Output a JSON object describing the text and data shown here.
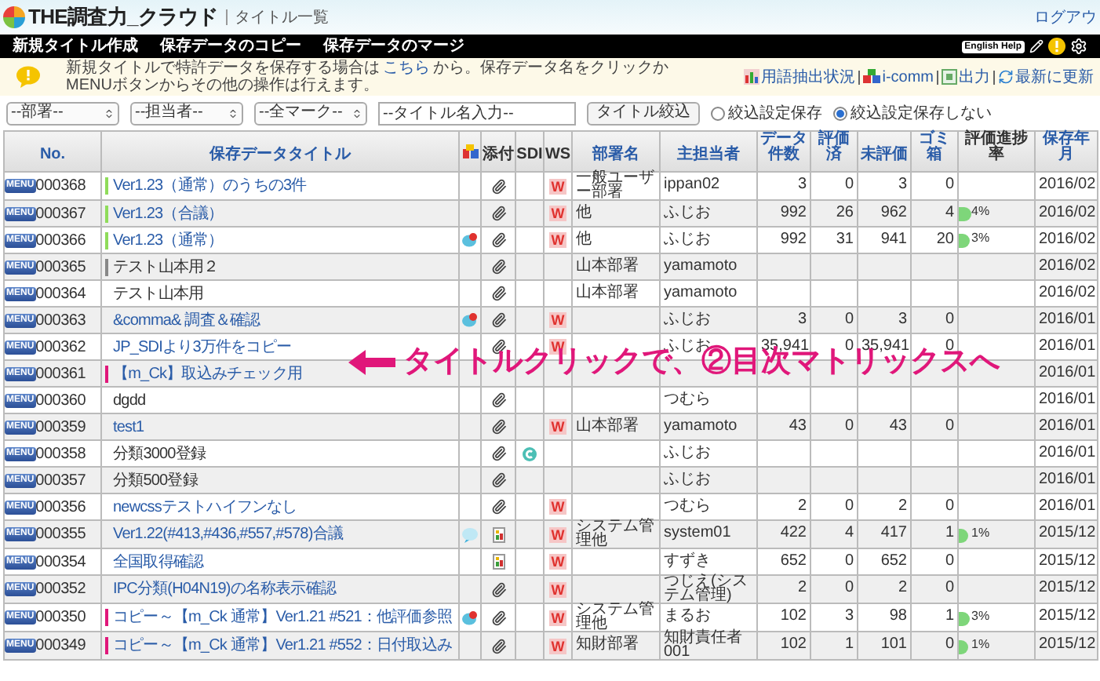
{
  "header": {
    "logo": "THE調査力_クラウド",
    "page_title": "タイトル一覧",
    "logout": "ログアウ"
  },
  "nav": {
    "items": [
      "新規タイトル作成",
      "保存データのコピー",
      "保存データのマージ"
    ],
    "help": "English Help"
  },
  "notice": {
    "text": "新規タイトルで特許データを保存する場合は",
    "link": "こちら",
    "text_after": "から。保存データ名をクリックかMENUボタンからその他の操作は行えます。",
    "links": [
      {
        "kind": "terms",
        "label": "用語抽出状況"
      },
      {
        "kind": "icomm",
        "label": "i-comm"
      },
      {
        "kind": "export",
        "label": "出力"
      },
      {
        "kind": "refresh",
        "label": "最新に更新"
      }
    ]
  },
  "filters": {
    "selects": [
      "--部署--",
      "--担当者--",
      "--全マーク--"
    ],
    "title_input": {
      "placeholder": "--タイトル名入力--"
    },
    "button": "タイトル絞込",
    "radios": [
      {
        "label": "絞込設定保存",
        "selected": false
      },
      {
        "label": "絞込設定保存しない",
        "selected": true
      }
    ]
  },
  "table": {
    "columns": [
      {
        "kind": "text",
        "label": "No.",
        "link": true
      },
      {
        "kind": "text",
        "label": "保存データタイトル",
        "link": true
      },
      {
        "kind": "icon"
      },
      {
        "kind": "text",
        "label": "添付",
        "link": false
      },
      {
        "kind": "text",
        "label": "SDI",
        "link": false
      },
      {
        "kind": "text",
        "label": "WS",
        "link": false
      },
      {
        "kind": "text",
        "label": "部署名",
        "link": true
      },
      {
        "kind": "text",
        "label": "主担当者",
        "link": true
      },
      {
        "kind": "text",
        "label": "データ件数",
        "link": true
      },
      {
        "kind": "text",
        "label": "評価済",
        "link": true
      },
      {
        "kind": "text",
        "label": "未評価",
        "link": true
      },
      {
        "kind": "text",
        "label": "ゴミ箱",
        "link": true
      },
      {
        "kind": "text",
        "label": "評価進捗率",
        "link": false
      },
      {
        "kind": "text",
        "label": "保存年月",
        "link": true
      }
    ],
    "rows": [
      {
        "menu": "MENU",
        "no": "000368",
        "title": "Ver1.23（通常）のうちの3件",
        "linked": true,
        "color": "#8fdc5a",
        "attachment": {
          "kind": "clip"
        },
        "ws": "W",
        "dept": "一般ユーザー部署",
        "owner": "ippan02",
        "count": "3",
        "done": "0",
        "undone": "3",
        "trash": "0",
        "date": "2016/02"
      },
      {
        "menu": "MENU",
        "no": "000367",
        "title": "Ver1.23（合議）",
        "linked": true,
        "color": "#8fdc5a",
        "attachment": {
          "kind": "clip"
        },
        "ws": "W",
        "dept": "他",
        "owner": "ふじお",
        "count": "992",
        "done": "26",
        "undone": "962",
        "trash": "4",
        "progress": {
          "label": "4%",
          "level": 0.04
        },
        "date": "2016/02"
      },
      {
        "menu": "MENU",
        "no": "000366",
        "title": "Ver1.23（通常）",
        "linked": true,
        "color": "#8fdc5a",
        "comment": {
          "kind": "alert"
        },
        "attachment": {
          "kind": "clip"
        },
        "ws": "W",
        "dept": "他",
        "owner": "ふじお",
        "count": "992",
        "done": "31",
        "undone": "941",
        "trash": "20",
        "progress": {
          "label": "3%",
          "level": 0.03
        },
        "date": "2016/02"
      },
      {
        "menu": "MENU",
        "no": "000365",
        "title": "テスト山本用２",
        "linked": false,
        "color": "#888888",
        "attachment": {
          "kind": "clip"
        },
        "dept": "山本部署",
        "owner": "yamamoto",
        "date": "2016/02"
      },
      {
        "menu": "MENU",
        "no": "000364",
        "title": "テスト山本用",
        "linked": false,
        "attachment": {
          "kind": "clip"
        },
        "dept": "山本部署",
        "owner": "yamamoto",
        "date": "2016/02"
      },
      {
        "menu": "MENU",
        "no": "000363",
        "title": "&comma& 調査＆確認",
        "linked": true,
        "comment": {
          "kind": "alert"
        },
        "attachment": {
          "kind": "clip"
        },
        "ws": "W",
        "owner": "ふじお",
        "count": "3",
        "done": "0",
        "undone": "3",
        "trash": "0",
        "date": "2016/01"
      },
      {
        "menu": "MENU",
        "no": "000362",
        "title": "JP_SDIより3万件をコピー",
        "linked": true,
        "attachment": {
          "kind": "clip"
        },
        "ws": "W",
        "owner": "ふじお",
        "count": "35,941",
        "done": "0",
        "undone": "35,941",
        "trash": "0",
        "date": "2016/01"
      },
      {
        "menu": "MENU",
        "no": "000361",
        "title": "【m_Ck】取込みチェック用",
        "linked": true,
        "color": "#e0177a",
        "date": "2016/01"
      },
      {
        "menu": "MENU",
        "no": "000360",
        "title": "dgdd",
        "linked": false,
        "attachment": {
          "kind": "clip"
        },
        "owner": "つむら",
        "date": "2016/01"
      },
      {
        "menu": "MENU",
        "no": "000359",
        "title": "test1",
        "linked": true,
        "attachment": {
          "kind": "clip"
        },
        "ws": "W",
        "dept": "山本部署",
        "owner": "yamamoto",
        "count": "43",
        "done": "0",
        "undone": "43",
        "trash": "0",
        "date": "2016/01"
      },
      {
        "menu": "MENU",
        "no": "000358",
        "title": "分類3000登録",
        "linked": false,
        "attachment": {
          "kind": "clip"
        },
        "sdi": true,
        "owner": "ふじお",
        "date": "2016/01"
      },
      {
        "menu": "MENU",
        "no": "000357",
        "title": "分類500登録",
        "linked": false,
        "attachment": {
          "kind": "clip"
        },
        "owner": "ふじお",
        "date": "2016/01"
      },
      {
        "menu": "MENU",
        "no": "000356",
        "title": "newcssテストハイフンなし",
        "linked": true,
        "attachment": {
          "kind": "clip"
        },
        "ws": "W",
        "owner": "つむら",
        "count": "2",
        "done": "0",
        "undone": "2",
        "trash": "0",
        "date": "2016/01"
      },
      {
        "menu": "MENU",
        "no": "000355",
        "title": "Ver1.22(#413,#436,#557,#578)合議",
        "linked": true,
        "comment": {
          "kind": "plain"
        },
        "attachment": {
          "kind": "chart"
        },
        "ws": "W",
        "dept": "システム管理他",
        "owner": "system01",
        "count": "422",
        "done": "4",
        "undone": "417",
        "trash": "1",
        "progress": {
          "label": "1%",
          "level": 0.01
        },
        "date": "2015/12"
      },
      {
        "menu": "MENU",
        "no": "000354",
        "title": "全国取得確認",
        "linked": true,
        "attachment": {
          "kind": "chart"
        },
        "ws": "W",
        "owner": "すずき",
        "count": "652",
        "done": "0",
        "undone": "652",
        "trash": "0",
        "date": "2015/12"
      },
      {
        "menu": "MENU",
        "no": "000352",
        "title": "IPC分類(H04N19)の名称表示確認",
        "linked": true,
        "attachment": {
          "kind": "clip"
        },
        "ws": "W",
        "owner": "つじえ(システム管理)",
        "count": "2",
        "done": "0",
        "undone": "2",
        "trash": "0",
        "date": "2015/12"
      },
      {
        "menu": "MENU",
        "no": "000350",
        "title": "コピー～【m_Ck 通常】Ver1.21 #521：他評価参照",
        "linked": true,
        "color": "#e0177a",
        "comment": {
          "kind": "alert"
        },
        "attachment": {
          "kind": "clip"
        },
        "ws": "W",
        "dept": "システム管理他",
        "owner": "まるお",
        "count": "102",
        "done": "3",
        "undone": "98",
        "trash": "1",
        "progress": {
          "label": "3%",
          "level": 0.03
        },
        "date": "2015/12"
      },
      {
        "menu": "MENU",
        "no": "000349",
        "title": "コピー～【m_Ck 通常】Ver1.21 #552：日付取込み",
        "linked": true,
        "color": "#e0177a",
        "attachment": {
          "kind": "clip"
        },
        "ws": "W",
        "dept": "知財部署",
        "owner": "知財責任者001",
        "count": "102",
        "done": "1",
        "undone": "101",
        "trash": "0",
        "progress": {
          "label": "1%",
          "level": 0.01
        },
        "date": "2015/12"
      }
    ]
  },
  "annotation": {
    "text": "タイトルクリックで、②目次マトリックスへ"
  }
}
